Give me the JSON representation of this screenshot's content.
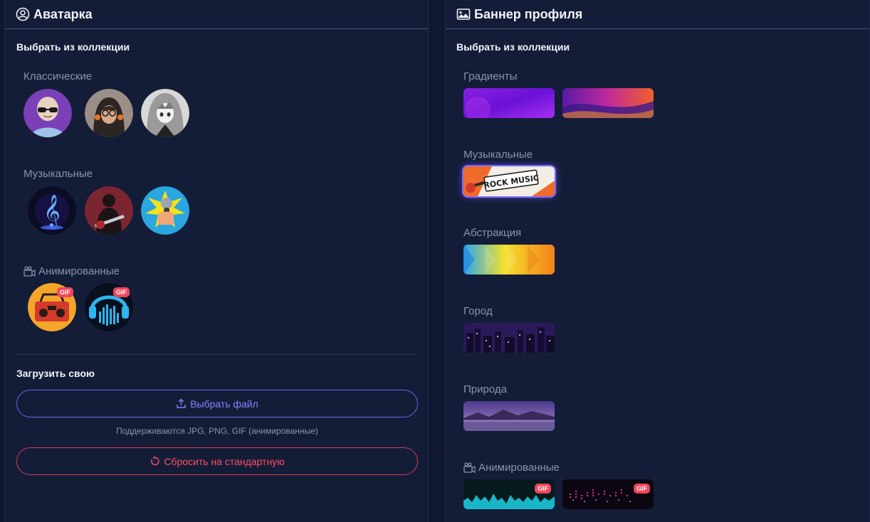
{
  "avatar_panel": {
    "title": "Аватарка",
    "collection_title": "Выбрать из коллекции",
    "groups": [
      {
        "label": "Классические",
        "icon": "",
        "items": [
          "bald-sunglasses-avatar",
          "hooded-girl-avatar",
          "anime-girl-avatar"
        ]
      },
      {
        "label": "Музыкальные",
        "icon": "",
        "items": [
          "treble-clef-avatar",
          "guitarist-avatar",
          "microphone-avatar"
        ]
      },
      {
        "label": "Анимированные",
        "icon": "video-camera-icon",
        "items": [
          "boombox-gif-avatar",
          "headphones-gif-avatar"
        ]
      }
    ],
    "gif_badge": "GIF",
    "upload_title": "Загрузить свою",
    "upload_button": "Выбрать файл",
    "upload_hint": "Поддерживаются JPG, PNG, GIF (анимированные)",
    "reset_button": "Сбросить на стандартную"
  },
  "banner_panel": {
    "title": "Баннер профиля",
    "collection_title": "Выбрать из коллекции",
    "groups": [
      {
        "label": "Градиенты",
        "icon": ""
      },
      {
        "label": "Музыкальные",
        "icon": ""
      },
      {
        "label": "Абстракция",
        "icon": ""
      },
      {
        "label": "Город",
        "icon": ""
      },
      {
        "label": "Природа",
        "icon": ""
      },
      {
        "label": "Анимированные",
        "icon": "video-camera-icon"
      }
    ],
    "rock_banner_text": "ROCK MUSIC",
    "gif_badge": "GIF",
    "selected_banner": "rock-music-banner"
  },
  "colors": {
    "background": "#0f1830",
    "panel": "#141d38",
    "accent_purple": "#6d63e8",
    "danger_red": "#d93a55",
    "muted_text": "#8b93ad"
  }
}
